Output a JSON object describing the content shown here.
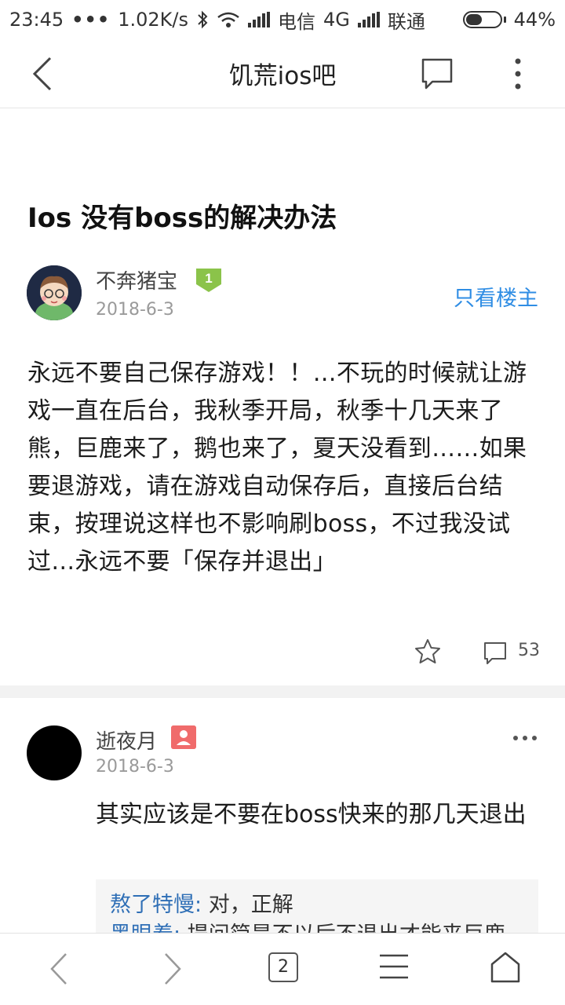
{
  "status_bar": {
    "time": "23:45",
    "dots": "•••",
    "speed": "1.02K/s",
    "carrier1": "电信",
    "network": "4G",
    "carrier2": "联通",
    "battery_percent": "44%",
    "battery_level": 0.44
  },
  "nav": {
    "title": "饥荒ios吧",
    "icons": [
      "back-arrow-icon",
      "comment-icon",
      "more-vertical-icon"
    ]
  },
  "post": {
    "title": "Ios 没有boss的解决办法",
    "author": "不奔猪宝",
    "level": "1",
    "date": "2018-6-3",
    "only_op_label": "只看楼主",
    "content": "永远不要自己保存游戏！！…不玩的时候就让游戏一直在后台，我秋季开局，秋季十几天来了熊，巨鹿来了，鹅也来了，夏天没看到……如果要退游戏，请在游戏自动保存后，直接后台结束，按理说这样也不影响刷boss，不过我没试过…永远不要「保存并退出」",
    "comment_count": "53"
  },
  "reply": {
    "author": "逝夜月",
    "date": "2018-6-3",
    "content": "其实应该是不要在boss快来的那几天退出",
    "sub_replies": [
      {
        "user": "熬了特慢:",
        "text": " 对，正解"
      },
      {
        "user": "黑眼着:",
        "text": " 提问简是不以后不退出才能来巨鹿"
      }
    ]
  },
  "bottom_bar": {
    "tab_count": "2",
    "icons": [
      "back-icon",
      "forward-icon",
      "tabs-icon",
      "menu-icon",
      "home-icon"
    ]
  },
  "colors": {
    "accent": "#2f8de4",
    "username": "#2f6fb6",
    "level_badge": "#8bc34a",
    "reply_badge": "#f06b6b"
  }
}
